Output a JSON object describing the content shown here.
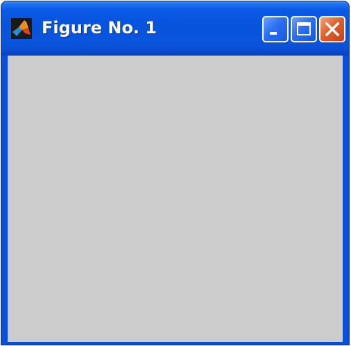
{
  "window": {
    "title": "Figure No. 1"
  },
  "titlebar": {
    "app_icon": "matlab-logo-icon",
    "buttons": [
      {
        "name": "minimize",
        "icon": "minimize-icon"
      },
      {
        "name": "maximize",
        "icon": "maximize-icon"
      },
      {
        "name": "close",
        "icon": "close-icon"
      }
    ]
  },
  "colors": {
    "titlebar_blue": "#0a55de",
    "close_button": "#e0602e",
    "figure_background": "#cccccc"
  }
}
